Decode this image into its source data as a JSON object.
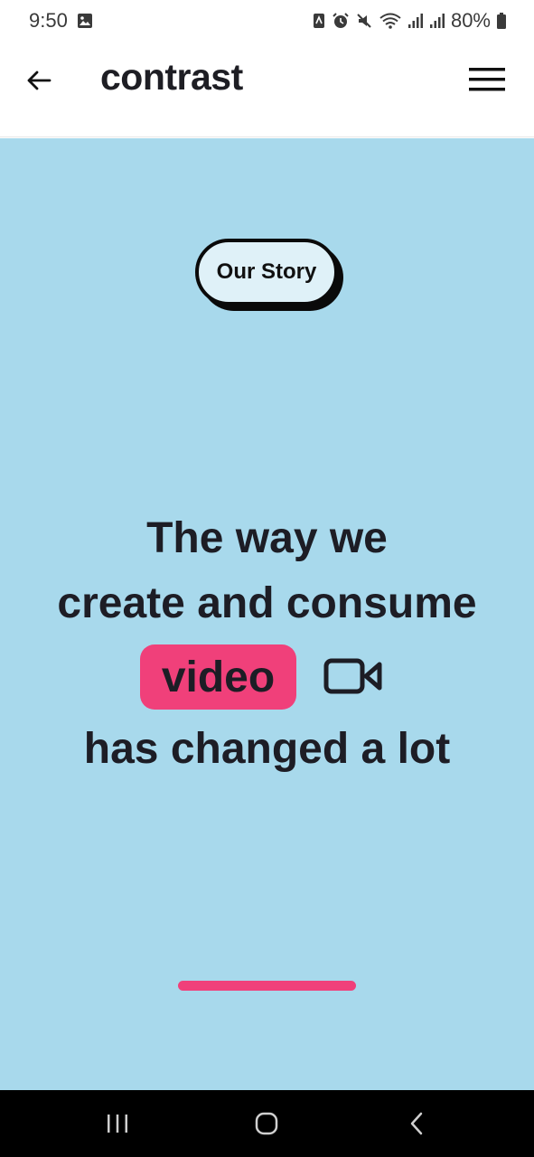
{
  "status_bar": {
    "time": "9:50",
    "battery": "80%",
    "icons": [
      "image-icon",
      "nfc-icon",
      "alarm-icon",
      "mute-icon",
      "wifi-icon",
      "signal-icon",
      "signal-icon",
      "battery-icon"
    ]
  },
  "app_bar": {
    "title": "contrast",
    "back_icon": "arrow-left-icon",
    "menu_icon": "hamburger-menu-icon"
  },
  "hero": {
    "pill_label": "Our Story",
    "headline_line1": "The way we",
    "headline_line2": "create and consume",
    "highlight_word": "video",
    "video_icon": "video-camera-icon",
    "headline_line4": "has changed a lot",
    "progress": 1.0
  },
  "colors": {
    "hero_background": "#a8d9ec",
    "accent_pink": "#f0407a",
    "text_dark": "#1d1d25",
    "pill_fill": "#dff1f8"
  },
  "nav_bar": {
    "icons": [
      "recent-apps-icon",
      "home-icon",
      "back-icon"
    ]
  }
}
